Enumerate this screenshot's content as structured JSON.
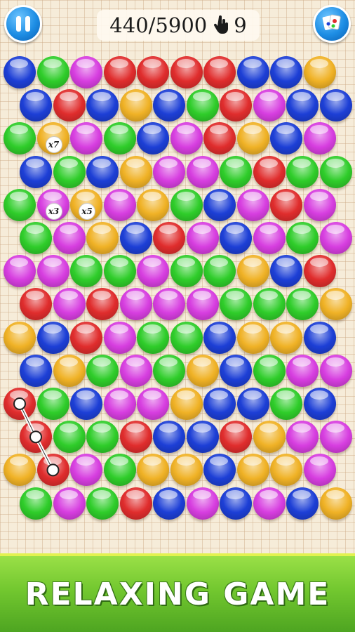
{
  "hud": {
    "score_text": "440/5900",
    "moves": "9",
    "pause_icon": "pause-icon",
    "powerup_icon": "cards-powerup-icon",
    "hand_icon": "hand-pointer-icon"
  },
  "colors": {
    "B": "#1d3fd6",
    "G": "#2fcd2a",
    "M": "#d73ee0",
    "R": "#e02d2d",
    "O": "#f0b226"
  },
  "board": {
    "rows": [
      "BGMRRRRBBO",
      "BRBOBGRMBB",
      "GOMGBMROBM",
      "BGBOMMGRGG",
      "GMOMOGBMRM",
      "GMOBRMBMGM",
      "MMGGMGGOBR",
      "RMRMMMGGGO",
      "OBRMGGBOOB",
      "BOGMGOBGMM",
      "RGBMMOBBGB",
      "RGGRBBROMM",
      "ORMGOOBOOM",
      "GMGRBMBMBO"
    ],
    "multipliers": [
      {
        "row": 2,
        "col": 1,
        "label": "x7"
      },
      {
        "row": 4,
        "col": 1,
        "label": "x3"
      },
      {
        "row": 4,
        "col": 2,
        "label": "x5"
      }
    ],
    "chain": [
      {
        "row": 10,
        "col": 0
      },
      {
        "row": 11,
        "col": 0
      },
      {
        "row": 12,
        "col": 1
      }
    ]
  },
  "banner": {
    "text": "RELAXING GAME"
  }
}
